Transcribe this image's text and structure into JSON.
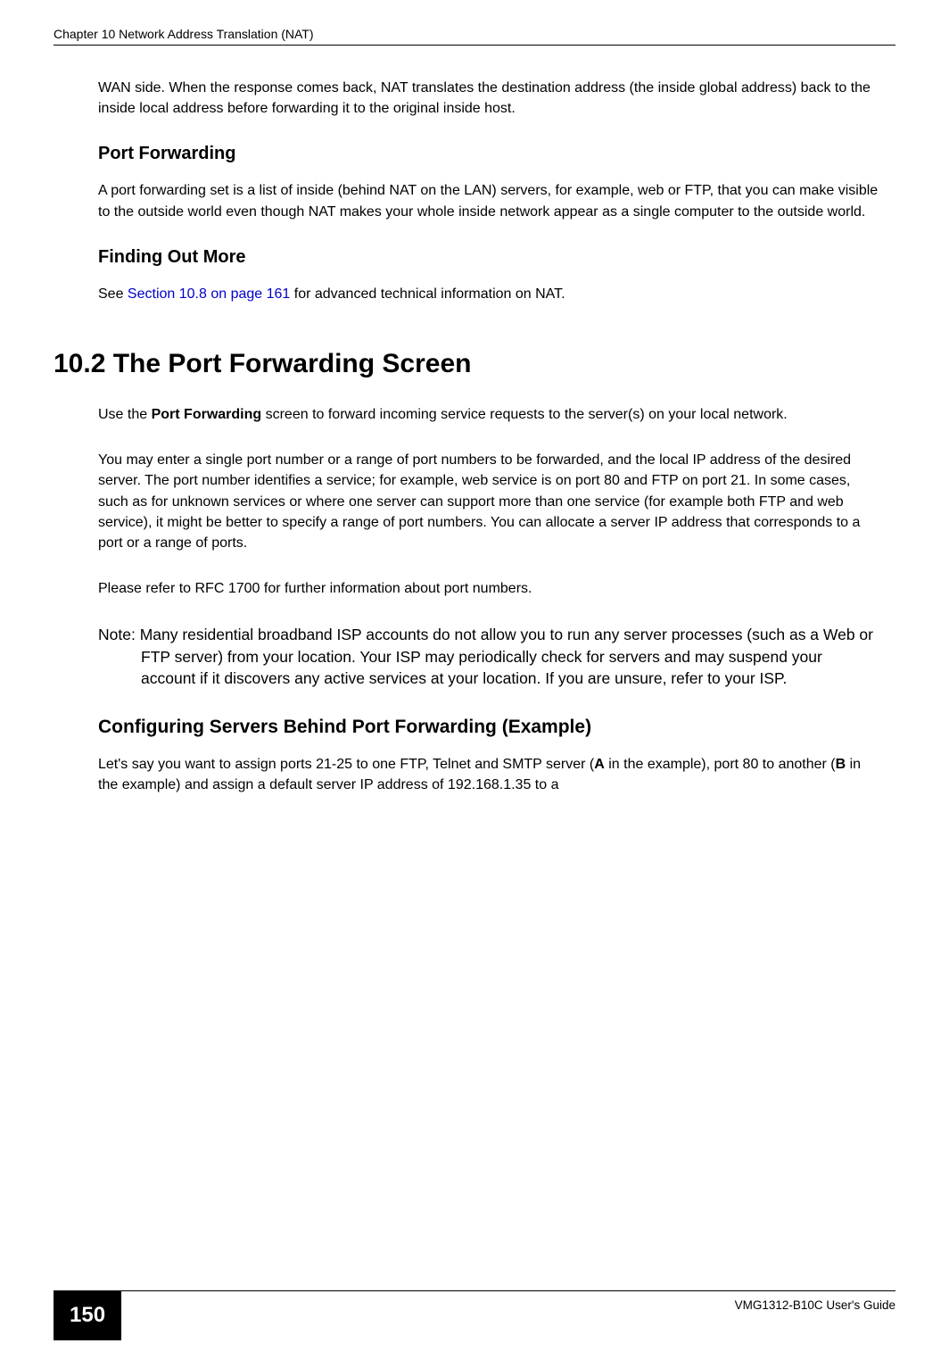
{
  "header": {
    "chapter": "Chapter 10 Network Address Translation (NAT)"
  },
  "content": {
    "intro_para": "WAN side. When the response comes back, NAT translates the destination address (the inside global address) back to the inside local address before forwarding it to the original inside host.",
    "port_forwarding_heading": "Port Forwarding",
    "port_forwarding_para": "A port forwarding set is a list of inside (behind NAT on the LAN) servers, for example, web or FTP, that you can make visible to the outside world even though NAT makes your whole inside network appear as a single computer to the outside world.",
    "finding_out_heading": "Finding Out More",
    "finding_out_pre": "See ",
    "finding_out_link": "Section 10.8 on page 161",
    "finding_out_post": " for advanced technical information on NAT.",
    "section_heading": "10.2  The Port Forwarding Screen",
    "use_pre": "Use the ",
    "use_bold": "Port Forwarding",
    "use_post": " screen to forward incoming service requests to the server(s) on your local network.",
    "single_port_para": "You may enter a single port number or a range of port numbers to be forwarded, and the local IP address of the desired server. The port number identifies a service; for example, web service is on port 80 and FTP on port 21. In some cases, such as for unknown services or where one server can support more than one service (for example both FTP and web service), it might be better to specify a range of port numbers. You can allocate a server IP address that corresponds to a port or a range of ports.",
    "rfc_para": "Please refer to RFC 1700 for further information about port numbers.",
    "note_text": "Note: Many residential broadband ISP accounts do not allow you to run any server processes (such as a Web or FTP server) from your location. Your ISP may periodically check for servers and may suspend your account if it discovers any active services at your location. If you are unsure, refer to your ISP.",
    "config_heading": "Configuring Servers Behind Port Forwarding (Example)",
    "config_para_pre": "Let's say you want to assign ports 21-25 to one FTP, Telnet and SMTP server (",
    "config_a": "A",
    "config_para_mid": " in the example), port 80 to another (",
    "config_b": "B",
    "config_para_post": " in the example) and assign a default server IP address of 192.168.1.35 to a"
  },
  "footer": {
    "page_number": "150",
    "guide": "VMG1312-B10C User's Guide"
  }
}
